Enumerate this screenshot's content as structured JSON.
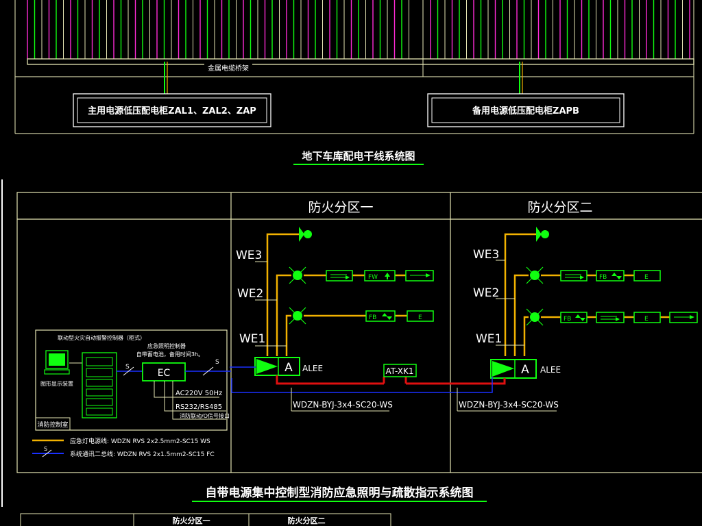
{
  "top": {
    "busbar_label": "金属电缆桥架",
    "main_cabinet_label": "主用电源低压配电柜ZAL1、ZAL2、ZAP",
    "backup_cabinet_label": "备用电源低压配电柜ZAPB",
    "title": "地下车库配电干线系统图"
  },
  "zones": {
    "zone1_title": "防火分区一",
    "zone2_title": "防火分区二",
    "we3": "WE3",
    "we2": "WE2",
    "we1": "WE1",
    "alee": "ALEE",
    "panel_letter": "A",
    "at_xk1": "AT-XK1",
    "cable": "WDZN-BYJ-3x4-SC20-WS",
    "fw": "FW",
    "fb": "FB",
    "e": "E"
  },
  "control_room": {
    "fire_alarm_controller": "联动型火灾自动报警控制器（柜式）",
    "graphic_display": "图形显示装置",
    "room_label": "消防控制室",
    "ec_title_line1": "应急照明控制器",
    "ec_title_line2": "自带蓄电池，备用时间3h。",
    "ec_label": "EC",
    "ac_label": "AC220V 50Hz",
    "rs_label": "RS232/RS485",
    "link_label": "消防联动/O信号接口",
    "s": "S"
  },
  "legend": {
    "line1": "应急灯电源线: WDZN RVS 2x2.5mm2-SC15 WS",
    "line2": "系统通讯二总线: WDZN RVS 2x1.5mm2-SC15 FC",
    "s": "S"
  },
  "bottom": {
    "title": "自带电源集中控制型消防应急照明与疏散指示系统图",
    "table_col1": "防火分区一",
    "table_col2": "防火分区二"
  },
  "colors": {
    "frame": "#e6e6b4",
    "green": "#10ff10",
    "orange": "#f2b200",
    "red": "#e01010",
    "blue": "#1a30ff",
    "white": "#ffffff"
  }
}
